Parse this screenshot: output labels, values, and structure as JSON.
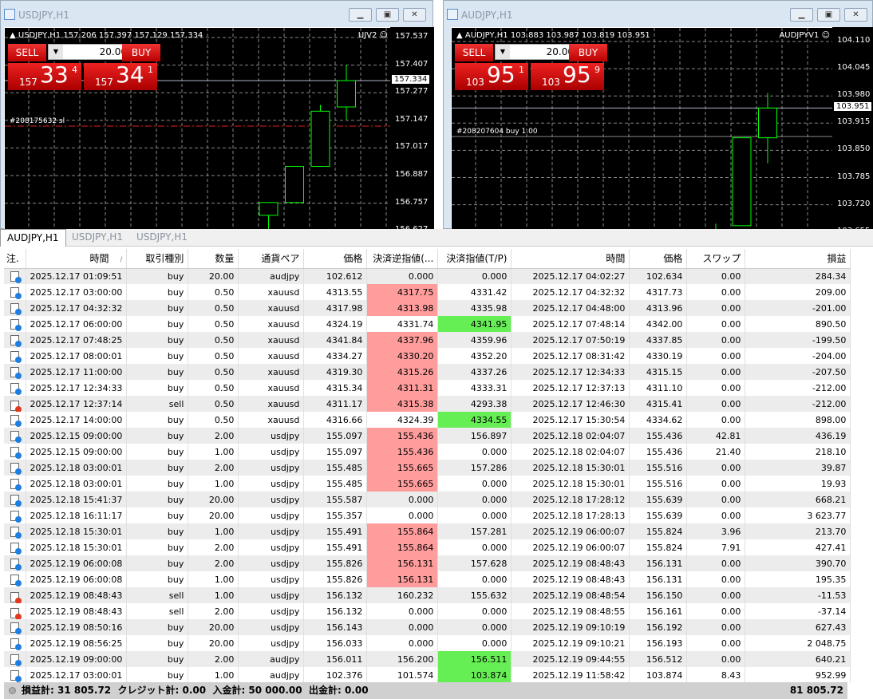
{
  "windows": [
    {
      "title": "USDJPY,H1",
      "header": "USDJPY,H1  157.206 157.397 157.129 157.334",
      "ea": "UJV2",
      "sell_label": "SELL",
      "buy_label": "BUY",
      "lot": "20.00",
      "bid": {
        "prefix": "157",
        "big": "33",
        "sup": "4"
      },
      "ask": {
        "prefix": "157",
        "big": "34",
        "sup": "1"
      },
      "order_label": "#208175632 sl",
      "axis_labels": [
        "157.537",
        "157.407",
        "157.277",
        "157.147",
        "157.017",
        "156.887",
        "156.757",
        "156.627"
      ],
      "current_price": "157.334",
      "axis_range": [
        156.627,
        157.537
      ],
      "candles": [
        {
          "o": 156.7,
          "h": 156.76,
          "l": 156.6,
          "c": 156.76
        },
        {
          "o": 156.76,
          "h": 156.93,
          "l": 156.76,
          "c": 156.93
        },
        {
          "o": 156.93,
          "h": 157.22,
          "l": 156.93,
          "c": 157.19
        },
        {
          "o": 157.21,
          "h": 157.407,
          "l": 157.15,
          "c": 157.334
        }
      ],
      "order_price": 157.12
    },
    {
      "title": "AUDJPY,H1",
      "header": "AUDJPY,H1  103.883 103.987 103.819 103.951",
      "ea": "AUDJPYV1",
      "sell_label": "SELL",
      "buy_label": "BUY",
      "lot": "20.00",
      "bid": {
        "prefix": "103",
        "big": "95",
        "sup": "1"
      },
      "ask": {
        "prefix": "103",
        "big": "95",
        "sup": "9"
      },
      "order_label": "#208207604 buy 1.00",
      "axis_labels": [
        "104.110",
        "104.045",
        "103.980",
        "103.915",
        "103.850",
        "103.785",
        "103.720",
        "103.655"
      ],
      "current_price": "103.951",
      "axis_range": [
        103.655,
        104.11
      ],
      "candles": [
        {
          "o": 103.64,
          "h": 103.675,
          "l": 103.6,
          "c": 103.655
        },
        {
          "o": 103.67,
          "h": 103.88,
          "l": 103.67,
          "c": 103.88
        },
        {
          "o": 103.88,
          "h": 103.987,
          "l": 103.819,
          "c": 103.951
        }
      ],
      "order_price": 103.883
    }
  ],
  "tabs": [
    "AUDJPY,H1",
    "USDJPY,H1",
    "USDJPY,H1"
  ],
  "table": {
    "headers": [
      "注.",
      "時間",
      "取引種別",
      "数量",
      "通貨ペア",
      "価格",
      "決済逆指値(...",
      "決済指値(T/P)",
      "時間",
      "価格",
      "スワップ",
      "損益"
    ],
    "sort_indicator": "/",
    "rows": [
      [
        "2025.12.17 01:09:51",
        "buy",
        "20.00",
        "audjpy",
        "102.612",
        "0.000",
        "0.000",
        "2025.12.17 04:02:27",
        "102.634",
        "0.00",
        "284.34",
        "",
        ""
      ],
      [
        "2025.12.17 03:00:00",
        "buy",
        "0.50",
        "xauusd",
        "4313.55",
        "4317.75",
        "4331.42",
        "2025.12.17 04:32:32",
        "4317.73",
        "0.00",
        "209.00",
        "red",
        ""
      ],
      [
        "2025.12.17 04:32:32",
        "buy",
        "0.50",
        "xauusd",
        "4317.98",
        "4313.98",
        "4335.98",
        "2025.12.17 04:48:00",
        "4313.96",
        "0.00",
        "-201.00",
        "red",
        ""
      ],
      [
        "2025.12.17 06:00:00",
        "buy",
        "0.50",
        "xauusd",
        "4324.19",
        "4331.74",
        "4341.95",
        "2025.12.17 07:48:14",
        "4342.00",
        "0.00",
        "890.50",
        "",
        "green"
      ],
      [
        "2025.12.17 07:48:25",
        "buy",
        "0.50",
        "xauusd",
        "4341.84",
        "4337.96",
        "4359.96",
        "2025.12.17 07:50:19",
        "4337.85",
        "0.00",
        "-199.50",
        "red",
        ""
      ],
      [
        "2025.12.17 08:00:01",
        "buy",
        "0.50",
        "xauusd",
        "4334.27",
        "4330.20",
        "4352.20",
        "2025.12.17 08:31:42",
        "4330.19",
        "0.00",
        "-204.00",
        "red",
        ""
      ],
      [
        "2025.12.17 11:00:00",
        "buy",
        "0.50",
        "xauusd",
        "4319.30",
        "4315.26",
        "4337.26",
        "2025.12.17 12:34:33",
        "4315.15",
        "0.00",
        "-207.50",
        "red",
        ""
      ],
      [
        "2025.12.17 12:34:33",
        "buy",
        "0.50",
        "xauusd",
        "4315.34",
        "4311.31",
        "4333.31",
        "2025.12.17 12:37:13",
        "4311.10",
        "0.00",
        "-212.00",
        "red",
        ""
      ],
      [
        "2025.12.17 12:37:14",
        "sell",
        "0.50",
        "xauusd",
        "4311.17",
        "4315.38",
        "4293.38",
        "2025.12.17 12:46:30",
        "4315.41",
        "0.00",
        "-212.00",
        "red",
        ""
      ],
      [
        "2025.12.17 14:00:00",
        "buy",
        "0.50",
        "xauusd",
        "4316.66",
        "4324.39",
        "4334.55",
        "2025.12.17 15:30:54",
        "4334.62",
        "0.00",
        "898.00",
        "",
        "green"
      ],
      [
        "2025.12.15 09:00:00",
        "buy",
        "2.00",
        "usdjpy",
        "155.097",
        "155.436",
        "156.897",
        "2025.12.18 02:04:07",
        "155.436",
        "42.81",
        "436.19",
        "red",
        ""
      ],
      [
        "2025.12.15 09:00:00",
        "buy",
        "1.00",
        "usdjpy",
        "155.097",
        "155.436",
        "0.000",
        "2025.12.18 02:04:07",
        "155.436",
        "21.40",
        "218.10",
        "red",
        ""
      ],
      [
        "2025.12.18 03:00:01",
        "buy",
        "2.00",
        "usdjpy",
        "155.485",
        "155.665",
        "157.286",
        "2025.12.18 15:30:01",
        "155.516",
        "0.00",
        "39.87",
        "red",
        ""
      ],
      [
        "2025.12.18 03:00:01",
        "buy",
        "1.00",
        "usdjpy",
        "155.485",
        "155.665",
        "0.000",
        "2025.12.18 15:30:01",
        "155.516",
        "0.00",
        "19.93",
        "red",
        ""
      ],
      [
        "2025.12.18 15:41:37",
        "buy",
        "20.00",
        "usdjpy",
        "155.587",
        "0.000",
        "0.000",
        "2025.12.18 17:28:12",
        "155.639",
        "0.00",
        "668.21",
        "",
        ""
      ],
      [
        "2025.12.18 16:11:17",
        "buy",
        "20.00",
        "usdjpy",
        "155.357",
        "0.000",
        "0.000",
        "2025.12.18 17:28:13",
        "155.639",
        "0.00",
        "3 623.77",
        "",
        ""
      ],
      [
        "2025.12.18 15:30:01",
        "buy",
        "1.00",
        "usdjpy",
        "155.491",
        "155.864",
        "157.281",
        "2025.12.19 06:00:07",
        "155.824",
        "3.96",
        "213.70",
        "red",
        ""
      ],
      [
        "2025.12.18 15:30:01",
        "buy",
        "2.00",
        "usdjpy",
        "155.491",
        "155.864",
        "0.000",
        "2025.12.19 06:00:07",
        "155.824",
        "7.91",
        "427.41",
        "red",
        ""
      ],
      [
        "2025.12.19 06:00:08",
        "buy",
        "2.00",
        "usdjpy",
        "155.826",
        "156.131",
        "157.628",
        "2025.12.19 08:48:43",
        "156.131",
        "0.00",
        "390.70",
        "red",
        ""
      ],
      [
        "2025.12.19 06:00:08",
        "buy",
        "1.00",
        "usdjpy",
        "155.826",
        "156.131",
        "0.000",
        "2025.12.19 08:48:43",
        "156.131",
        "0.00",
        "195.35",
        "red",
        ""
      ],
      [
        "2025.12.19 08:48:43",
        "sell",
        "1.00",
        "usdjpy",
        "156.132",
        "160.232",
        "155.632",
        "2025.12.19 08:48:54",
        "156.150",
        "0.00",
        "-11.53",
        "",
        ""
      ],
      [
        "2025.12.19 08:48:43",
        "sell",
        "2.00",
        "usdjpy",
        "156.132",
        "0.000",
        "0.000",
        "2025.12.19 08:48:55",
        "156.161",
        "0.00",
        "-37.14",
        "",
        ""
      ],
      [
        "2025.12.19 08:50:16",
        "buy",
        "20.00",
        "usdjpy",
        "156.143",
        "0.000",
        "0.000",
        "2025.12.19 09:10:19",
        "156.192",
        "0.00",
        "627.43",
        "",
        ""
      ],
      [
        "2025.12.19 08:56:25",
        "buy",
        "20.00",
        "usdjpy",
        "156.033",
        "0.000",
        "0.000",
        "2025.12.19 09:10:21",
        "156.193",
        "0.00",
        "2 048.75",
        "",
        ""
      ],
      [
        "2025.12.19 09:00:00",
        "buy",
        "2.00",
        "audjpy",
        "156.011",
        "156.200",
        "156.511",
        "2025.12.19 09:44:55",
        "156.512",
        "0.00",
        "640.21",
        "",
        "green"
      ],
      [
        "2025.12.17 03:00:01",
        "buy",
        "1.00",
        "audjpy",
        "102.376",
        "101.574",
        "103.874",
        "2025.12.19 11:58:42",
        "103.874",
        "8.43",
        "952.99",
        "",
        "green"
      ]
    ]
  },
  "footer": {
    "summary": "損益計: 31 805.72  クレジット計: 0.00  入金計: 50 000.00  出金計: 0.00",
    "total": "81 805.72"
  },
  "colors": {
    "sl_highlight": "#ff9c9c",
    "tp_highlight": "#66ee55",
    "bull_candle": "#00ff00",
    "sell_button": "#d01010"
  }
}
